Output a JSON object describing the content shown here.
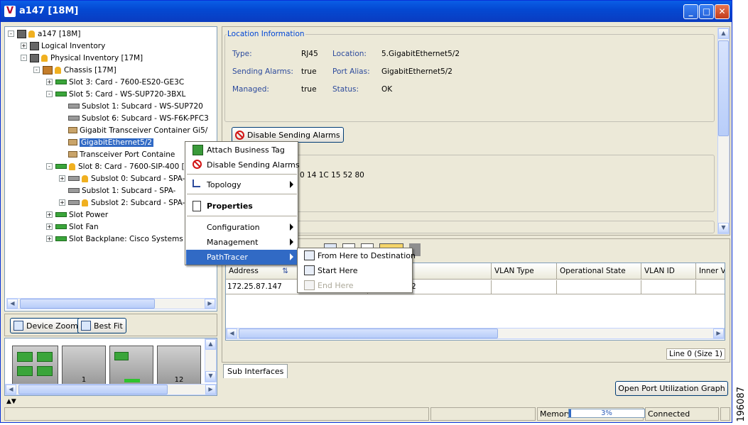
{
  "window": {
    "title": "a147 [18M]",
    "logo_letter": "V",
    "minimize": "_",
    "maximize": "□",
    "close": "✕"
  },
  "tree": {
    "nodes": [
      {
        "label": "a147 [18M]",
        "expander": "-",
        "icon": "router-icon",
        "alarm": true
      },
      {
        "label": "Logical Inventory",
        "expander": "+",
        "icon": "logical-inventory-icon",
        "alarm": false
      },
      {
        "label": "Physical Inventory [17M]",
        "expander": "-",
        "icon": "physical-inventory-icon",
        "alarm": true
      },
      {
        "label": "Chassis [17M]",
        "expander": "-",
        "icon": "chassis-icon",
        "alarm": true
      },
      {
        "label": "Slot 3: Card - 7600-ES20-GE3C",
        "expander": "+",
        "icon": "card-icon",
        "alarm": false
      },
      {
        "label": "Slot 5: Card - WS-SUP720-3BXL",
        "expander": "-",
        "icon": "card-icon",
        "alarm": false
      },
      {
        "label": "Subslot 1: Subcard - WS-SUP720",
        "expander": "",
        "icon": "subcard-icon",
        "alarm": false
      },
      {
        "label": "Subslot 6: Subcard - WS-F6K-PFC3",
        "expander": "",
        "icon": "subcard-icon",
        "alarm": false
      },
      {
        "label": "Gigabit Transceiver Container Gi5/",
        "expander": "",
        "icon": "port-icon",
        "alarm": false
      },
      {
        "label": "GigabitEthernet5/2",
        "expander": "",
        "icon": "port-icon",
        "alarm": false,
        "selected": true
      },
      {
        "label": "Transceiver Port Containe",
        "expander": "",
        "icon": "port-icon",
        "alarm": false
      },
      {
        "label": "Slot 8: Card - 7600-SIP-400 [",
        "expander": "-",
        "icon": "card-icon",
        "alarm": true
      },
      {
        "label": "Subslot 0: Subcard - SPA-",
        "expander": "+",
        "icon": "subcard-icon",
        "alarm": true
      },
      {
        "label": "Subslot 1: Subcard - SPA-",
        "expander": "",
        "icon": "subcard-icon",
        "alarm": false
      },
      {
        "label": "Subslot 2: Subcard - SPA-",
        "expander": "+",
        "icon": "subcard-icon",
        "alarm": true
      },
      {
        "label": "Slot Power",
        "expander": "+",
        "icon": "card-icon",
        "alarm": false
      },
      {
        "label": "Slot Fan",
        "expander": "+",
        "icon": "card-icon",
        "alarm": false
      },
      {
        "label": "Slot Backplane: Cisco Systems",
        "expander": "+",
        "icon": "card-icon",
        "alarm": false
      }
    ]
  },
  "zoom": {
    "device_zoom": "Device Zoom",
    "best_fit": "Best Fit"
  },
  "device_view": {
    "slot_labels": [
      "1",
      "12"
    ]
  },
  "location_info": {
    "title": "Location Information",
    "type_label": "Type:",
    "type_value": "RJ45",
    "location_label": "Location:",
    "location_value": "5.GigabitEthernet5/2",
    "sending_alarms_label": "Sending Alarms:",
    "sending_alarms_value": "true",
    "port_alias_label": "Port Alias:",
    "port_alias_value": "GigabitEthernet5/2",
    "managed_label": "Managed:",
    "managed_value": "true",
    "status_label": "Status:",
    "status_value": "OK",
    "disable_button": "Disable Sending Alarms",
    "partial_mac": "0 14 1C 15 52 80"
  },
  "table": {
    "columns": [
      "Address",
      "VLAN Type",
      "Operational State",
      "VLAN ID",
      "Inner VI"
    ],
    "sort_indicator": "⇅",
    "rows": [
      {
        "address": "172.25.87.147",
        "hidden_suffix": "2"
      }
    ],
    "line_info": "Line 0 (Size 1)"
  },
  "tabs": {
    "sub_interfaces": "Sub Interfaces"
  },
  "open_port_button": "Open Port Utilization Graph",
  "status_bar": {
    "memory_label": "Memory:",
    "memory_value": "3%",
    "memory_fraction": 0.03,
    "connection": "Connected"
  },
  "context_menu": {
    "items": [
      {
        "label": "Attach Business Tag",
        "icon": "tag-icon",
        "submenu": false
      },
      {
        "label": "Disable Sending Alarms",
        "icon": "no-alarm-icon",
        "submenu": false
      },
      {
        "label": "Topology",
        "icon": "topology-icon",
        "submenu": true
      },
      {
        "label": "Properties",
        "icon": "properties-icon",
        "submenu": false,
        "bold": true
      },
      {
        "label": "Configuration",
        "icon": "",
        "submenu": true
      },
      {
        "label": "Management",
        "icon": "",
        "submenu": true
      },
      {
        "label": "PathTracer",
        "icon": "",
        "submenu": true,
        "highlighted": true
      }
    ]
  },
  "pathtracer_submenu": {
    "items": [
      {
        "label": "From Here to Destination",
        "enabled": true
      },
      {
        "label": "Start Here",
        "enabled": true
      },
      {
        "label": "End Here",
        "enabled": false
      }
    ]
  },
  "side_label": "196087",
  "colors": {
    "title_bar": "#0a5ee6",
    "selection": "#316ac5",
    "label_blue": "#2c4a9c",
    "group_title": "#0046d5"
  }
}
